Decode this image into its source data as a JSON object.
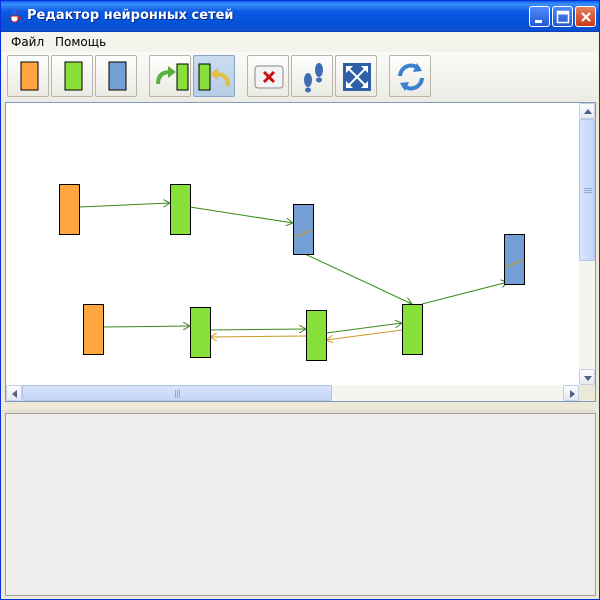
{
  "window": {
    "title": "Редактор нейронных сетей"
  },
  "menu": {
    "items": [
      "Файл",
      "Помощь"
    ]
  },
  "toolbar": {
    "buttons": [
      {
        "name": "add-input-neuron-button",
        "icon": "orange-neuron-icon",
        "color": "#ffa640"
      },
      {
        "name": "add-hidden-neuron-button",
        "icon": "green-neuron-icon",
        "color": "#88e03a"
      },
      {
        "name": "add-output-neuron-button",
        "icon": "blue-neuron-icon",
        "color": "#739fd4"
      },
      {
        "name": "connect-forward-button",
        "icon": "forward-connection-icon"
      },
      {
        "name": "connect-backward-button",
        "icon": "backward-connection-icon",
        "pressed": true
      },
      {
        "name": "delete-button",
        "icon": "delete-icon"
      },
      {
        "name": "step-button",
        "icon": "footprints-icon"
      },
      {
        "name": "fit-view-button",
        "icon": "fullscreen-icon"
      },
      {
        "name": "refresh-button",
        "icon": "refresh-icon"
      }
    ]
  },
  "colors": {
    "input": "#ffa640",
    "hidden": "#88e03a",
    "output": "#739fd4",
    "forward_link": "#3a8a1a",
    "backward_link": "#c89a20"
  },
  "network": {
    "neurons": [
      {
        "id": "in1",
        "type": "input"
      },
      {
        "id": "h1",
        "type": "hidden"
      },
      {
        "id": "out1",
        "type": "output"
      },
      {
        "id": "out2",
        "type": "output"
      },
      {
        "id": "in2",
        "type": "input"
      },
      {
        "id": "h2",
        "type": "hidden"
      },
      {
        "id": "h3",
        "type": "hidden"
      },
      {
        "id": "h4",
        "type": "hidden"
      }
    ],
    "links": [
      {
        "from": "in1",
        "to": "h1",
        "kind": "forward"
      },
      {
        "from": "h1",
        "to": "out1",
        "kind": "forward"
      },
      {
        "from": "out1",
        "to": "h4",
        "kind": "forward"
      },
      {
        "from": "h4",
        "to": "out2",
        "kind": "forward"
      },
      {
        "from": "in2",
        "to": "h2",
        "kind": "forward"
      },
      {
        "from": "h2",
        "to": "h3",
        "kind": "forward"
      },
      {
        "from": "h3",
        "to": "h2",
        "kind": "backward"
      },
      {
        "from": "h3",
        "to": "h4",
        "kind": "forward"
      },
      {
        "from": "h4",
        "to": "h3",
        "kind": "backward"
      }
    ]
  }
}
